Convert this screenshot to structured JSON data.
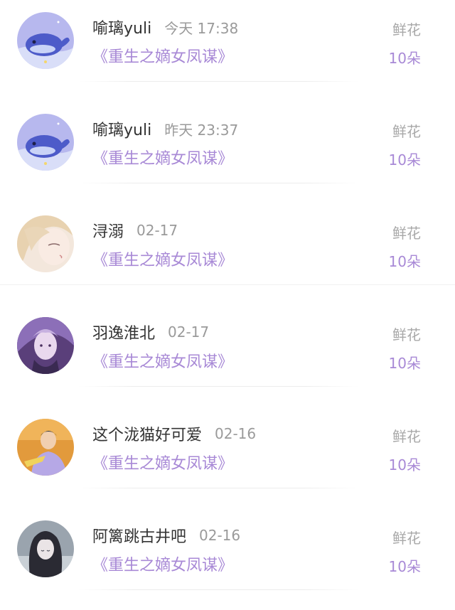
{
  "rows": [
    {
      "name": "喻璃yuli",
      "time": "今天 17:38",
      "book": "《重生之嫡女凤谋》",
      "gift_type": "鲜花",
      "gift_count": "10朵",
      "avatar_icon": "whale-avatar"
    },
    {
      "name": "喻璃yuli",
      "time": "昨天 23:37",
      "book": "《重生之嫡女凤谋》",
      "gift_type": "鲜花",
      "gift_count": "10朵",
      "avatar_icon": "whale-avatar"
    },
    {
      "name": "浔溺",
      "time": "02-17",
      "book": "《重生之嫡女凤谋》",
      "gift_type": "鲜花",
      "gift_count": "10朵",
      "avatar_icon": "anime-girl-avatar"
    },
    {
      "name": "羽逸淮北",
      "time": "02-17",
      "book": "《重生之嫡女凤谋》",
      "gift_type": "鲜花",
      "gift_count": "10朵",
      "avatar_icon": "anime-boy-avatar"
    },
    {
      "name": "这个泷猫好可爱",
      "time": "02-16",
      "book": "《重生之嫡女凤谋》",
      "gift_type": "鲜花",
      "gift_count": "10朵",
      "avatar_icon": "person-photo-avatar"
    },
    {
      "name": "阿篱跳古井吧",
      "time": "02-16",
      "book": "《重生之嫡女凤谋》",
      "gift_type": "鲜花",
      "gift_count": "10朵",
      "avatar_icon": "dark-girl-avatar"
    }
  ],
  "colors": {
    "book_accent": "#a889d6",
    "name": "#333333",
    "muted": "#9a9a9a"
  }
}
